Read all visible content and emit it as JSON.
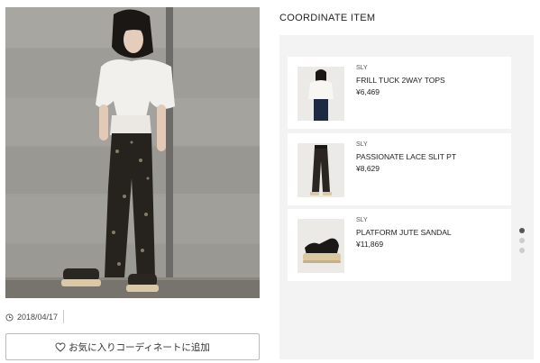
{
  "post": {
    "date": "2018/04/17",
    "favorite_button_label": "お気に入りコーディネートに追加"
  },
  "coordinate": {
    "title": "COORDINATE ITEM",
    "items": [
      {
        "brand": "SLY",
        "name": "FRILL TUCK 2WAY TOPS",
        "price": "¥6,469"
      },
      {
        "brand": "SLY",
        "name": "PASSIONATE LACE SLIT PT",
        "price": "¥8,629"
      },
      {
        "brand": "SLY",
        "name": "PLATFORM JUTE SANDAL",
        "price": "¥11,869"
      }
    ],
    "pager": {
      "pages": 3,
      "active_index": 0
    }
  },
  "icons": {
    "date": "clock-icon",
    "favorite": "heart-icon"
  }
}
